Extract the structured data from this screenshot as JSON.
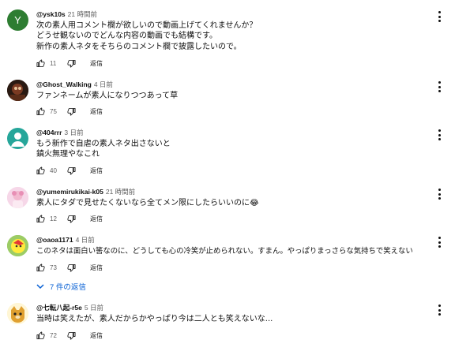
{
  "comments": [
    {
      "author": "@ysk10s",
      "time": "21 時間前",
      "avatar_letter": "Y",
      "avatar_color": "#2e7d32",
      "lines": [
        "次の素人用コメント欄が欲しいので動画上げてくれませんか？",
        "どうせ観ないのでどんな内容の動画でも結構です。",
        "新作の素人ネタをそちらのコメント欄で披露したいので。"
      ],
      "likes": "11",
      "reply_label": "返信"
    },
    {
      "author": "@Ghost_Walking",
      "time": "4 日前",
      "lines": [
        "ファンネームが素人になりつつあって草"
      ],
      "likes": "75",
      "reply_label": "返信"
    },
    {
      "author": "@404rrr",
      "time": "3 日前",
      "lines": [
        "もう新作で自虐の素人ネタ出さないと",
        "鎮火無理やなこれ"
      ],
      "likes": "40",
      "reply_label": "返信"
    },
    {
      "author": "@yumemirukikai-k05",
      "time": "21 時間前",
      "lines": [
        "素人にタダで見せたくないなら全てメン限にしたらいいのに😂"
      ],
      "likes": "12",
      "reply_label": "返信"
    },
    {
      "author": "@oaoa1171",
      "time": "4 日前",
      "lines": [
        "このネタは面白い筈なのに、どうしても心の冷笑が止められない。すまん。やっぱりまっさらな気持ちで笑えない"
      ],
      "likes": "73",
      "reply_label": "返信",
      "replies_label": "7 件の返信"
    },
    {
      "author": "@七転八起-r5e",
      "time": "5 日前",
      "lines": [
        "当時は笑えたが、素人だからかやっぱり今は二人とも笑えないな..."
      ],
      "likes": "72",
      "reply_label": "返信"
    }
  ],
  "colors": {
    "text": "#0f0f0f",
    "secondary": "#606060",
    "link": "#065fd4"
  },
  "icons": [
    "thumb-up-icon",
    "thumb-down-icon",
    "more-vert-icon",
    "chevron-down-icon"
  ]
}
